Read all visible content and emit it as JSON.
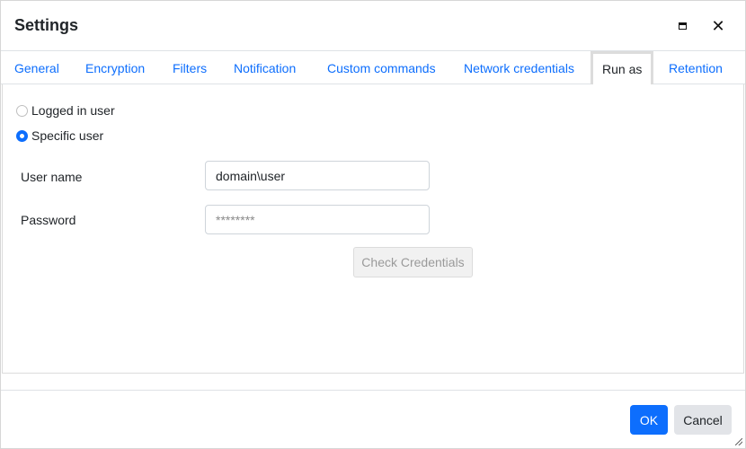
{
  "window": {
    "title": "Settings",
    "maximize_icon": "maximize-icon",
    "close_glyph": "✕"
  },
  "tabs": [
    {
      "label": "General",
      "active": false
    },
    {
      "label": "Encryption",
      "active": false
    },
    {
      "label": "Filters",
      "active": false
    },
    {
      "label": "Notification",
      "active": false
    },
    {
      "label": "Custom commands",
      "active": false
    },
    {
      "label": "Network credentials",
      "active": false
    },
    {
      "label": "Run as",
      "active": true
    },
    {
      "label": "Retention",
      "active": false
    }
  ],
  "run_as": {
    "options": [
      {
        "label": "Logged in user",
        "checked": false
      },
      {
        "label": "Specific user",
        "checked": true
      }
    ],
    "username": {
      "label": "User name",
      "value": "domain\\user"
    },
    "password": {
      "label": "Password",
      "value": "",
      "placeholder": "********"
    },
    "check_button": {
      "label": "Check Credentials",
      "disabled": true
    }
  },
  "footer": {
    "ok_label": "OK",
    "cancel_label": "Cancel"
  }
}
